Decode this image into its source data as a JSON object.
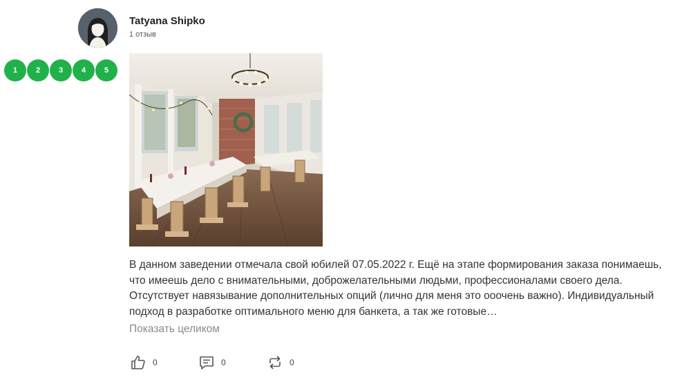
{
  "author": {
    "name": "Tatyana Shipko",
    "review_count": "1 отзыв"
  },
  "rating": {
    "stars": [
      "1",
      "2",
      "3",
      "4",
      "5"
    ],
    "value": 5,
    "color": "#21b14b"
  },
  "photo": {
    "subject": "restaurant banquet hall"
  },
  "review": {
    "text": "В данном заведении отмечала свой юбилей 07.05.2022 г. Ещё на этапе формирования заказа понимаешь, что имеешь дело с внимательными, доброжелательными людьми, профессионалами своего дела. Отсутствует навязывание дополнительных опций (лично для меня это ооочень важно). Индивидуальный подход в разработке оптимального меню для банкета, а так же готовые…",
    "show_full_label": "Показать целиком"
  },
  "actions": {
    "likes": "0",
    "comments": "0",
    "reposts": "0"
  }
}
